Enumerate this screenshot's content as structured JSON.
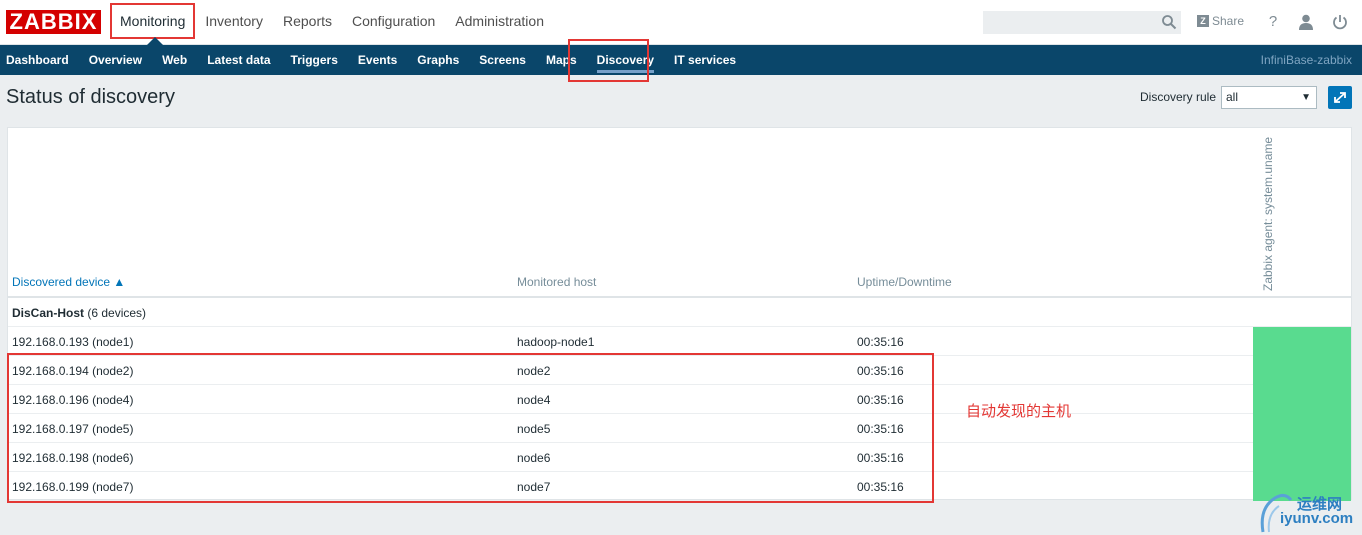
{
  "header": {
    "logo": "ZABBIX",
    "main_menu": [
      "Monitoring",
      "Inventory",
      "Reports",
      "Configuration",
      "Administration"
    ],
    "active_main": "Monitoring",
    "search_placeholder": "",
    "share_label": "Share",
    "share_box": "Z",
    "help_icon": "?"
  },
  "subnav": {
    "items": [
      "Dashboard",
      "Overview",
      "Web",
      "Latest data",
      "Triggers",
      "Events",
      "Graphs",
      "Screens",
      "Maps",
      "Discovery",
      "IT services"
    ],
    "active": "Discovery",
    "server_name": "InfiniBase-zabbix"
  },
  "page": {
    "title": "Status of discovery",
    "filter_label": "Discovery rule",
    "filter_value": "all"
  },
  "table": {
    "columns": {
      "device": "Discovered device ▲",
      "monitored_host": "Monitored host",
      "uptime": "Uptime/Downtime",
      "check": "Zabbix agent: system.uname"
    },
    "group": {
      "name": "DisCan-Host",
      "count": "(6 devices)"
    },
    "rows": [
      {
        "device": "192.168.0.193 (node1)",
        "host": "hadoop-node1",
        "uptime": "00:35:16"
      },
      {
        "device": "192.168.0.194 (node2)",
        "host": "node2",
        "uptime": "00:35:16"
      },
      {
        "device": "192.168.0.196 (node4)",
        "host": "node4",
        "uptime": "00:35:16"
      },
      {
        "device": "192.168.0.197 (node5)",
        "host": "node5",
        "uptime": "00:35:16"
      },
      {
        "device": "192.168.0.198 (node6)",
        "host": "node6",
        "uptime": "00:35:16"
      },
      {
        "device": "192.168.0.199 (node7)",
        "host": "node7",
        "uptime": "00:35:16"
      }
    ],
    "status_color": "#59db8f"
  },
  "annotation": "自动发现的主机",
  "watermark": {
    "line1": "运维网",
    "line2": "iyunv.com"
  },
  "colors": {
    "brand_red": "#d40000",
    "nav_bg": "#0a466a",
    "link": "#0275b8",
    "highlight": "#e33734"
  }
}
